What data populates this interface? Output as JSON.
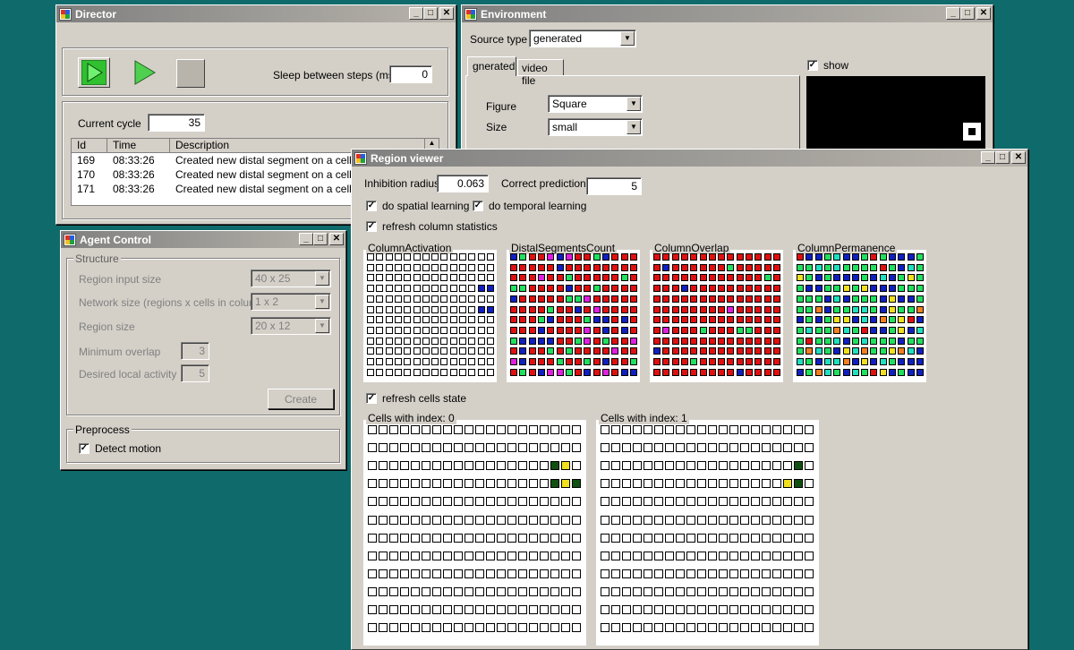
{
  "director": {
    "title": "Director",
    "sleep_label": "Sleep between steps (ms)",
    "sleep_value": "0",
    "cycle_label": "Current cycle",
    "cycle_value": "35",
    "log_columns": [
      "Id",
      "Time",
      "Description"
    ],
    "log_rows": [
      {
        "id": "169",
        "time": "08:33:26",
        "desc": "Created new distal segment on a cell on c"
      },
      {
        "id": "170",
        "time": "08:33:26",
        "desc": "Created new distal segment on a cell on c"
      },
      {
        "id": "171",
        "time": "08:33:26",
        "desc": "Created new distal segment on a cell on c"
      }
    ]
  },
  "environment": {
    "title": "Environment",
    "source_label": "Source type",
    "source_value": "generated",
    "tabs": [
      "gnerated",
      "video file"
    ],
    "figure_label": "Figure",
    "figure_value": "Square",
    "size_label": "Size",
    "size_value": "small",
    "show_label": "show"
  },
  "agent": {
    "title": "Agent Control",
    "structure_label": "Structure",
    "region_input_label": "Region input size",
    "region_input_value": "40 x  25",
    "network_label": "Network size (regions x cells in column)",
    "network_value": "1 x 2",
    "region_size_label": "Region size",
    "region_size_value": "20 x  12",
    "min_overlap_label": "Minimum overlap",
    "min_overlap_value": "3",
    "desired_label": "Desired local activity",
    "desired_value": "5",
    "create_label": "Create",
    "preprocess_label": "Preprocess",
    "detect_label": "Detect motion"
  },
  "region": {
    "title": "Region viewer",
    "inhibition_label": "Inhibition radius",
    "inhibition_value": "0.063",
    "correct_label": "Correct prediction",
    "correct_value": "5",
    "spatial_label": "do spatial learning",
    "temporal_label": "do temporal learning",
    "refresh_stats_label": "refresh column statistics",
    "grid_titles": [
      "ColumnActivation",
      "DistalSegmentsCount",
      "ColumnOverlap",
      "ColumnPermanence"
    ],
    "refresh_cells_label": "refresh cells state",
    "cells0_label": "Cells with index: 0",
    "cells1_label": "Cells with index: 1"
  },
  "colors": {
    "red": "#e01010",
    "blue": "#1020c0",
    "green": "#20e060",
    "yellow": "#f0e020",
    "dark_green": "#105010",
    "magenta": "#e020e0",
    "orange": "#f08020"
  }
}
